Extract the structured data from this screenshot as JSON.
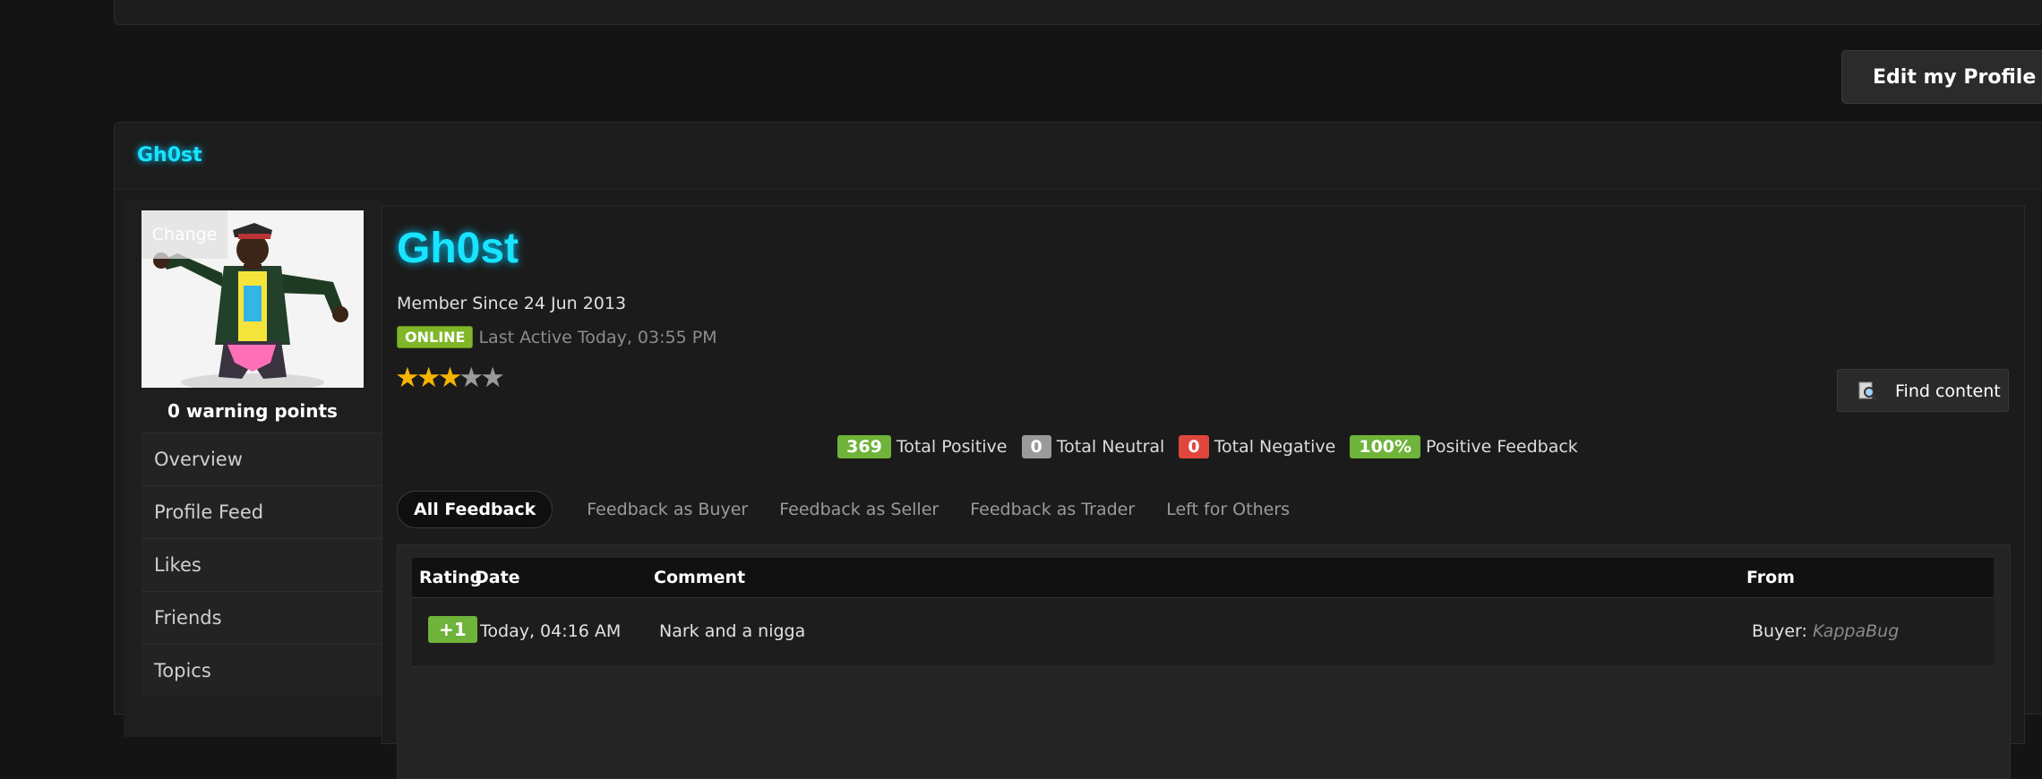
{
  "header": {
    "edit_profile_label": "Edit my Profile"
  },
  "profile": {
    "head_name": "Gh0st",
    "name": "Gh0st",
    "avatar_change_label": "Change",
    "warning_points": "0 warning points",
    "member_since": "Member Since 24 Jun 2013",
    "online_badge": "ONLINE",
    "last_active": "Last Active Today, 03:55 PM",
    "rating_stars": {
      "filled": 3,
      "total": 5
    },
    "find_content_label": "Find content"
  },
  "sidebar": {
    "items": [
      {
        "label": "Overview"
      },
      {
        "label": "Profile Feed"
      },
      {
        "label": "Likes"
      },
      {
        "label": "Friends"
      },
      {
        "label": "Topics"
      }
    ]
  },
  "summary": {
    "positive_count": "369",
    "positive_label": "Total Positive",
    "neutral_count": "0",
    "neutral_label": "Total Neutral",
    "negative_count": "0",
    "negative_label": "Total Negative",
    "positive_pct": "100%",
    "positive_pct_label": "Positive Feedback"
  },
  "tabs": [
    {
      "label": "All Feedback"
    },
    {
      "label": "Feedback as Buyer"
    },
    {
      "label": "Feedback as Seller"
    },
    {
      "label": "Feedback as Trader"
    },
    {
      "label": "Left for Others"
    }
  ],
  "table": {
    "columns": [
      "Rating",
      "Date",
      "Comment",
      "From"
    ],
    "rows": [
      {
        "rating": "+1",
        "date": "Today, 04:16 AM",
        "comment": "Nark and a nigga",
        "from_role": "Buyer:",
        "from_name": "KappaBug"
      }
    ]
  },
  "colors": {
    "accent_cyan": "#18e4ff",
    "online_green": "#7fb728",
    "positive_green": "#6fb33a",
    "neutral_grey": "#9a9a9a",
    "negative_red": "#e0463e"
  }
}
